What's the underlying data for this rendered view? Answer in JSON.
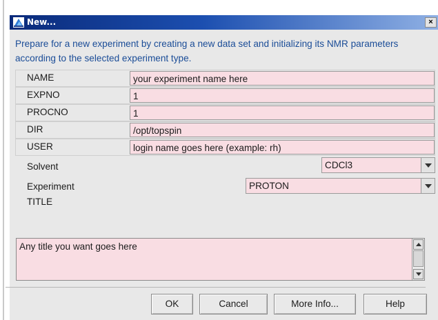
{
  "window": {
    "title": "New...",
    "close_symbol": "×"
  },
  "intro": "Prepare for a new experiment by creating a new data set and initializing its NMR parameters according to the selected experiment type.",
  "fields": [
    {
      "label": "NAME",
      "value": "your experiment name here"
    },
    {
      "label": "EXPNO",
      "value": "1"
    },
    {
      "label": "PROCNO",
      "value": "1"
    },
    {
      "label": "DIR",
      "value": "/opt/topspin"
    },
    {
      "label": "USER",
      "value": "login name goes here (example:  rh)"
    }
  ],
  "solvent": {
    "label": "Solvent",
    "value": "CDCl3"
  },
  "experiment": {
    "label": "Experiment",
    "value": "PROTON"
  },
  "title_field": {
    "label": "TITLE",
    "value": "Any title you want goes here"
  },
  "buttons": {
    "ok": "OK",
    "cancel": "Cancel",
    "more_info": "More Info...",
    "help": "Help"
  },
  "colors": {
    "titlebar_start": "#0a2a7a",
    "input_bg": "#f9dde3",
    "intro_text": "#1a4c97",
    "dialog_bg": "#e8e8e8"
  },
  "icons": {
    "app": "topspin-app-icon",
    "close": "close-icon",
    "dropdown": "chevron-down-icon"
  }
}
